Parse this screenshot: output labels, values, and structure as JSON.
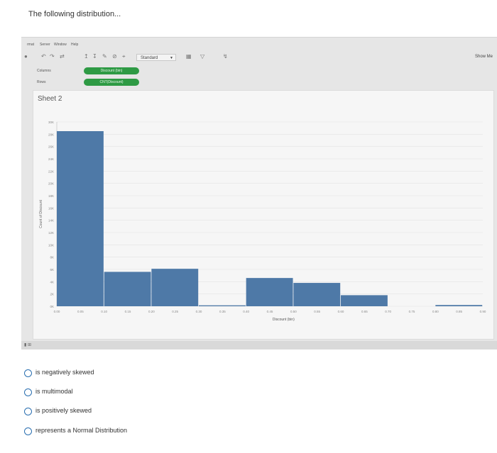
{
  "question": {
    "title": "The following distribution..."
  },
  "app": {
    "menu": [
      "rmat",
      "Server",
      "Window",
      "Help"
    ],
    "toolbar": {
      "mark_type": "Standard",
      "show_me": "Show Me",
      "icons": [
        "undo-icon",
        "redo-icon",
        "swap-icon",
        "sort-ascending-icon",
        "sort-descending-icon",
        "highlight-icon",
        "group-icon",
        "label-icon",
        "fix-axes-icon",
        "present-icon",
        "share-icon"
      ]
    },
    "shelves": {
      "columns": {
        "label": "Columns",
        "pill": "Discount (bin)"
      },
      "rows": {
        "label": "Rows",
        "pill": "CNT(Discount)"
      }
    },
    "sheet_title": "Sheet 2"
  },
  "chart_data": {
    "type": "bar",
    "xlabel": "Discount (bin)",
    "ylabel": "Count of Discount",
    "x_ticks": [
      "0.00",
      "0.05",
      "0.10",
      "0.15",
      "0.20",
      "0.25",
      "0.30",
      "0.35",
      "0.40",
      "0.45",
      "0.50",
      "0.55",
      "0.60",
      "0.65",
      "0.70",
      "0.75",
      "0.80",
      "0.85",
      "0.90"
    ],
    "y_ticks": [
      "0K",
      "2K",
      "4K",
      "6K",
      "8K",
      "10K",
      "12K",
      "14K",
      "16K",
      "18K",
      "20K",
      "22K",
      "24K",
      "26K",
      "28K",
      "30K"
    ],
    "ylim": [
      0,
      30000
    ],
    "bin_width": 0.1,
    "bins": [
      {
        "x": 0.0,
        "value": 28500
      },
      {
        "x": 0.1,
        "value": 5600
      },
      {
        "x": 0.2,
        "value": 6100
      },
      {
        "x": 0.3,
        "value": 150
      },
      {
        "x": 0.4,
        "value": 4600
      },
      {
        "x": 0.5,
        "value": 3800
      },
      {
        "x": 0.6,
        "value": 1800
      },
      {
        "x": 0.8,
        "value": 200
      }
    ],
    "bar_color": "#4e79a7",
    "grid": true
  },
  "options": [
    {
      "label": "is negatively skewed"
    },
    {
      "label": "is multimodal"
    },
    {
      "label": "is positively skewed"
    },
    {
      "label": "represents a Normal Distribution"
    }
  ]
}
